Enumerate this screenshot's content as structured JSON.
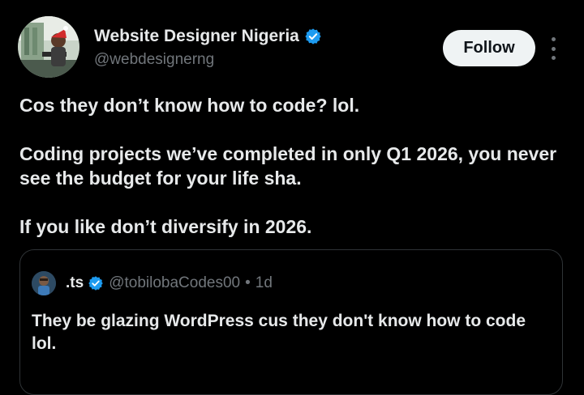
{
  "author": {
    "display_name": "Website Designer Nigeria",
    "handle": "@webdesignerng",
    "verified": true,
    "avatar": "profile-photo"
  },
  "actions": {
    "follow_label": "Follow",
    "more_icon": "more-vertical-icon"
  },
  "tweet": {
    "paragraphs": [
      "Cos they don’t know how to code? lol.",
      "Coding projects we’ve completed in only Q1 2026, you never see the budget for your life sha.",
      "If you like don’t diversify in 2026."
    ]
  },
  "quote": {
    "display_name": ".ts",
    "handle": "@tobilobaCodes00",
    "separator": "•",
    "time": "1d",
    "verified": true,
    "avatar": "cartoon-avatar",
    "text": "They be glazing WordPress cus they don't know how to code lol."
  },
  "colors": {
    "background": "#000000",
    "text_primary": "#e7e9ea",
    "text_secondary": "#71767b",
    "verified_blue": "#1d9bf0",
    "follow_bg": "#eff3f4",
    "border": "#2f3336"
  }
}
